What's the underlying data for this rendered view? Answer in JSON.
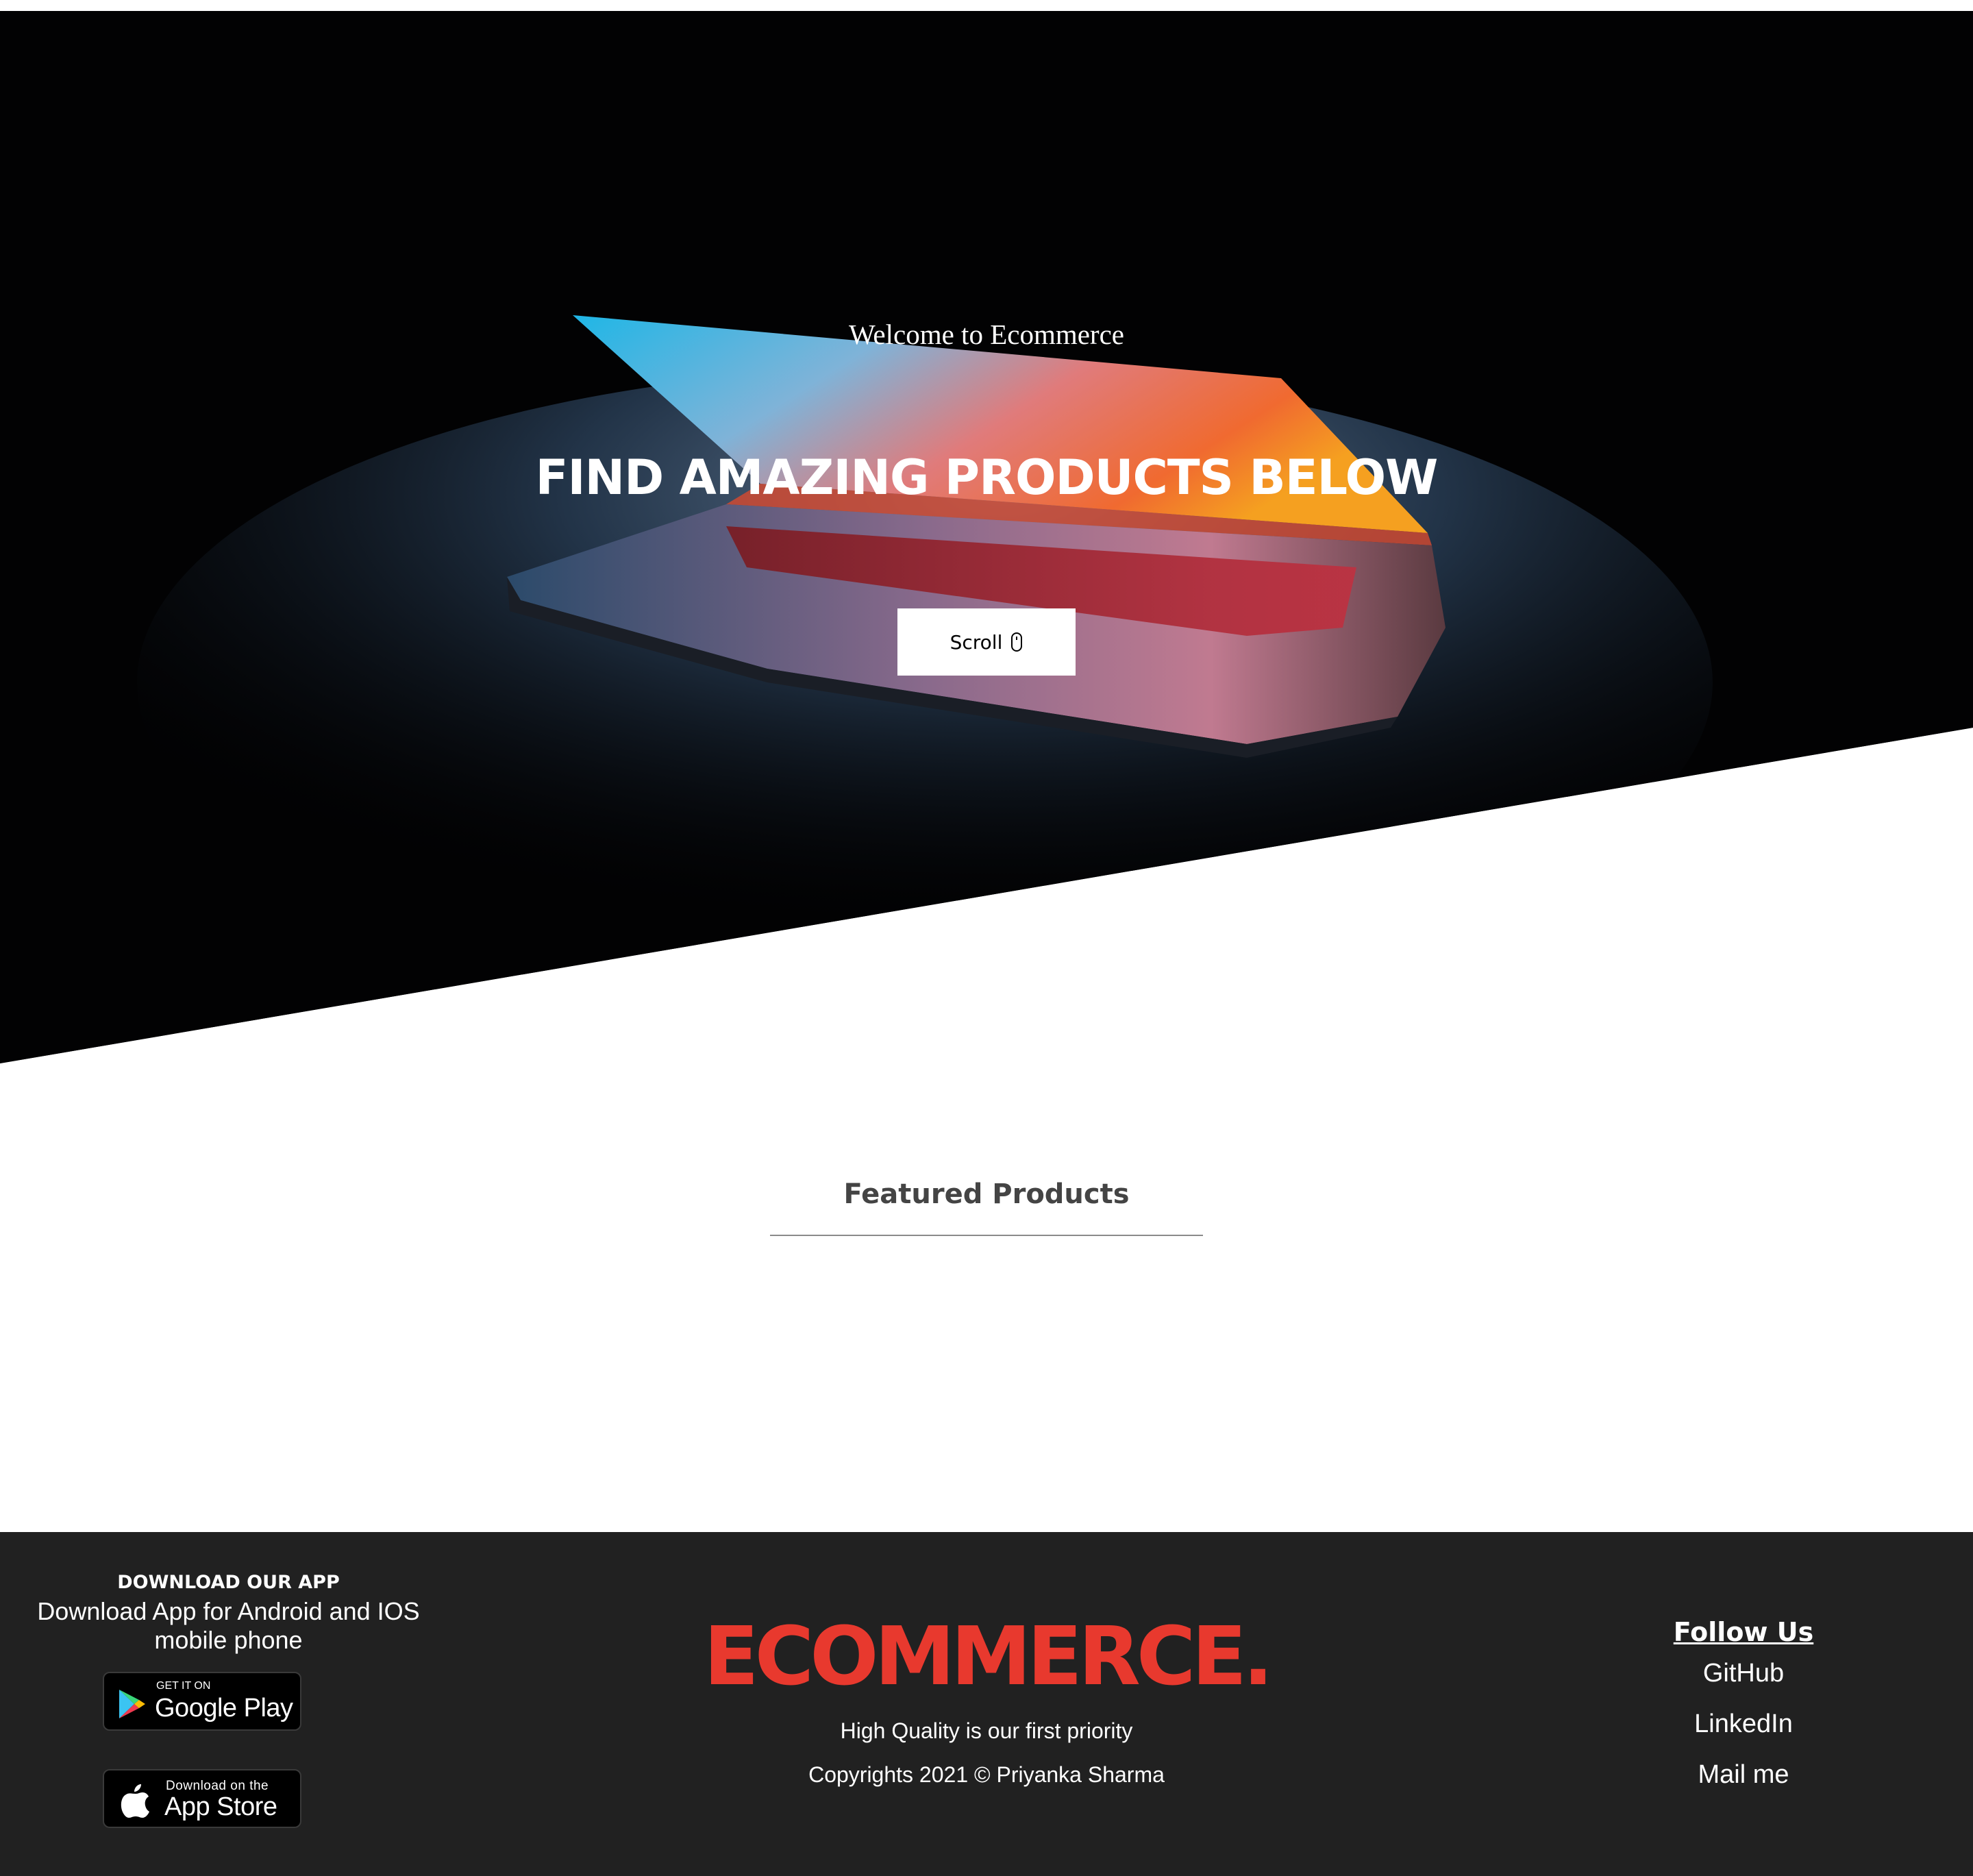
{
  "hero": {
    "welcome": "Welcome to Ecommerce",
    "headline": "FIND AMAZING PRODUCTS BELOW",
    "scroll_label": "Scroll",
    "scroll_icon": "mouse-icon"
  },
  "featured": {
    "title": "Featured Products"
  },
  "footer": {
    "app": {
      "heading": "DOWNLOAD OUR APP",
      "description": "Download App for Android and IOS mobile phone",
      "google_play": {
        "small": "GET IT ON",
        "big": "Google Play"
      },
      "app_store": {
        "small": "Download on the",
        "big": "App Store"
      }
    },
    "brand": "ECOMMERCE.",
    "tagline": "High Quality is our first priority",
    "copyright": "Copyrights 2021 © Priyanka Sharma",
    "follow": {
      "title": "Follow Us",
      "links": [
        "GitHub",
        "LinkedIn",
        "Mail me"
      ]
    }
  },
  "colors": {
    "brand_red": "#e8392e",
    "footer_bg": "#212121",
    "hero_bg": "#020203"
  }
}
